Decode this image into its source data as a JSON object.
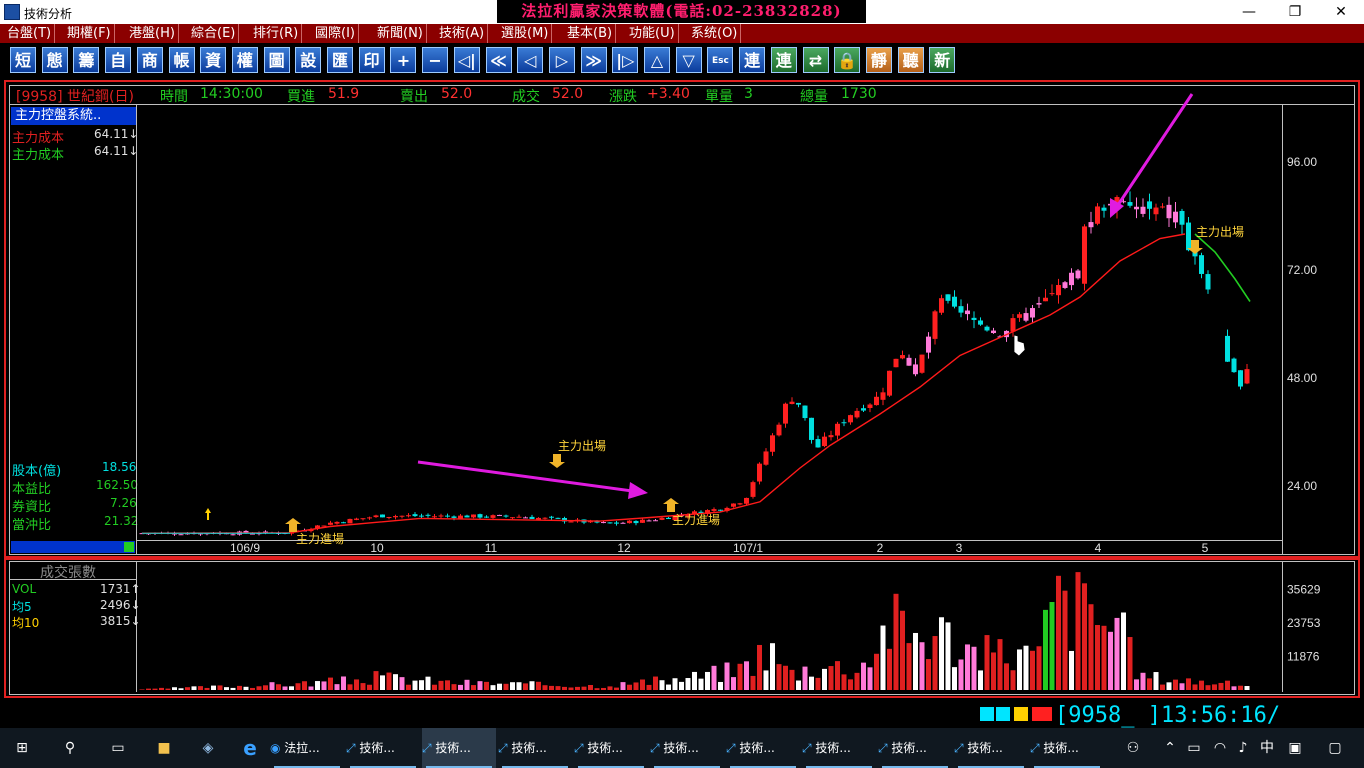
{
  "window": {
    "title": "技術分析",
    "banner": "法拉利贏家決策軟體(電話:02-23832828)"
  },
  "menu": [
    "台盤(T)",
    "期權(F)",
    "港盤(H)",
    "綜合(E)",
    "排行(R)",
    "國際(I)",
    "新聞(N)",
    "技術(A)",
    "選股(M)",
    "基本(B)",
    "功能(U)",
    "系统(O)"
  ],
  "toolbar": [
    "短",
    "態",
    "籌",
    "自",
    "商",
    "帳",
    "資",
    "權",
    "圖",
    "設",
    "匯",
    "印",
    "+",
    "−",
    "◁|",
    "≪",
    "◁",
    "▷",
    "≫",
    "|▷",
    "△",
    "▽",
    "Esc",
    "連",
    "連",
    "⇄",
    "🔒",
    "靜",
    "聽",
    "新"
  ],
  "quote": {
    "symbol": "[9958] 世紀鋼(日)",
    "time_label": "時間",
    "time": "14:30:00",
    "bid_label": "買進",
    "bid": "51.9",
    "ask_label": "賣出",
    "ask": "52.0",
    "trade_label": "成交",
    "trade": "52.0",
    "change_label": "漲跌",
    "change": "+3.40",
    "vol_label": "單量",
    "vol": "3",
    "total_label": "總量",
    "total": "1730"
  },
  "panel": {
    "header": "主力控盤系統..",
    "cost1_label": "主力成本",
    "cost1": "64.11↓",
    "cost2_label": "主力成本",
    "cost2": "64.11↓",
    "capital_label": "股本(億)",
    "capital": "18.56",
    "pe_label": "本益比",
    "pe": "162.50",
    "margin_label": "券資比",
    "margin": "7.26",
    "daytrade_label": "當沖比",
    "daytrade": "21.32"
  },
  "annotations": {
    "exit1": "主力出場",
    "enter1": "主力進場",
    "exit2": "主力出場",
    "enter_cut": "主力進場"
  },
  "vol_panel": {
    "title": "成交張數",
    "vol_label": "VOL",
    "vol": "1731↑",
    "ma5_label": "均5",
    "ma5": "2496↓",
    "ma10_label": "均10",
    "ma10": "3815↓"
  },
  "status": {
    "code": "[9958_ ]13:56:16/"
  },
  "taskbar": {
    "items": [
      "法拉...",
      "技術...",
      "技術...",
      "技術...",
      "技術...",
      "技術...",
      "技術...",
      "技術...",
      "技術...",
      "技術...",
      "技術..."
    ],
    "lang": "中"
  },
  "colors": {
    "menu_bg": "#8b0000",
    "banner": "#ff1e6e",
    "up": "#ff2020",
    "down": "#00e0e0",
    "flat": "#ff7ad9",
    "cost": "#ff1a1a",
    "forecast": "#22cc22",
    "arrow": "#e01be0"
  },
  "chart_data": [
    {
      "type": "candlestick",
      "title": "[9958] 世紀鋼(日)",
      "x_ticks": [
        "106/9",
        "10",
        "11",
        "12",
        "107/1",
        "2",
        "3",
        "4",
        "5"
      ],
      "y_ticks": [
        24.0,
        48.0,
        72.0,
        96.0
      ],
      "ylim": [
        12,
        108
      ],
      "close_approx": [
        {
          "x": "106/9",
          "v": 13.5
        },
        {
          "x": "10",
          "v": 17
        },
        {
          "x": "11",
          "v": 17.2
        },
        {
          "x": "12",
          "v": 15.8
        },
        {
          "x": "107/1",
          "v": 21
        },
        {
          "x": "2",
          "v": 46
        },
        {
          "x": "3",
          "v": 60
        },
        {
          "x": "4",
          "v": 80
        },
        {
          "x": "5",
          "v": 52
        }
      ],
      "series": [
        {
          "name": "主力成本",
          "values_approx": [
            13.5,
            15,
            16.5,
            16.5,
            18.5,
            32,
            50,
            70,
            64.11
          ]
        }
      ]
    },
    {
      "type": "bar",
      "title": "成交張數",
      "y_ticks": [
        11876,
        23753,
        35629
      ],
      "series": [
        {
          "name": "VOL",
          "last": 1731
        },
        {
          "name": "均5",
          "last": 2496
        },
        {
          "name": "均10",
          "last": 3815
        }
      ]
    }
  ]
}
